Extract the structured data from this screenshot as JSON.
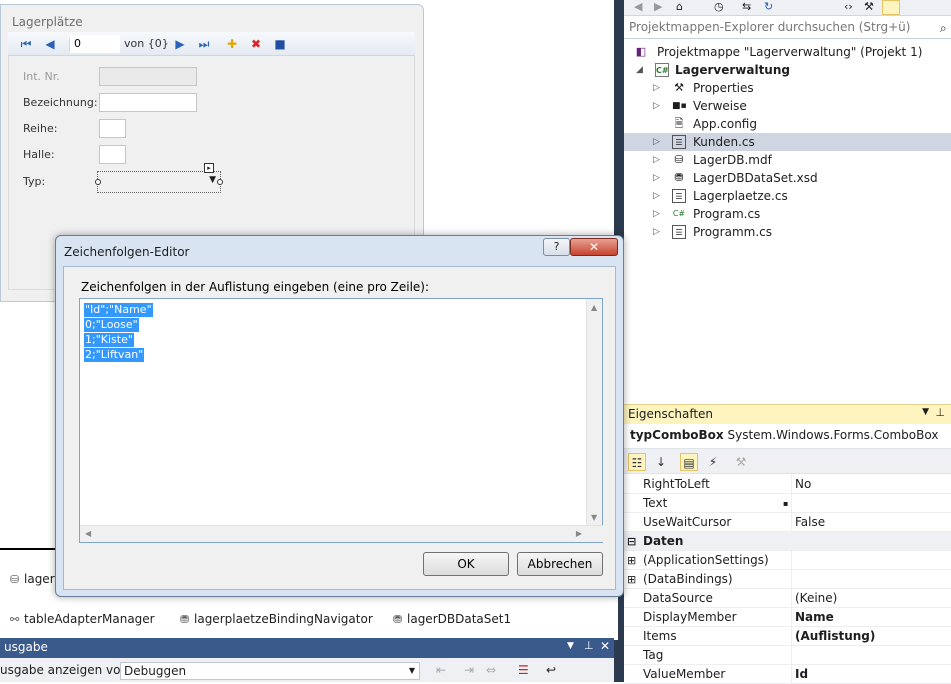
{
  "form": {
    "title": "Lagerplätze",
    "navigator": {
      "position": "0",
      "count_label": "von {0}"
    },
    "fields": [
      {
        "label": "Int. Nr."
      },
      {
        "label": "Bezeichnung:"
      },
      {
        "label": "Reihe:"
      },
      {
        "label": "Halle:"
      },
      {
        "label": "Typ:"
      }
    ]
  },
  "tray": {
    "items": [
      "lager",
      "tableAdapterManager",
      "lagerplaetzeBindingNavigator",
      "lagerDBDataSet1"
    ]
  },
  "output": {
    "title": "usgabe",
    "show_label": "usgabe anzeigen von:",
    "source": "Debuggen"
  },
  "dialog": {
    "title": "Zeichenfolgen-Editor",
    "help_label": "?",
    "close_label": "✕",
    "prompt": "Zeichenfolgen in der Auflistung eingeben (eine pro Zeile):",
    "lines": [
      "\"Id\";\"Name\"",
      "0;\"Loose\"",
      "1;\"Kiste\"",
      "2;\"Liftvan\""
    ],
    "ok_label": "OK",
    "cancel_label": "Abbrechen"
  },
  "solution_explorer": {
    "search_placeholder": "Projektmappen-Explorer durchsuchen (Strg+ü)",
    "items": [
      {
        "label": "Projektmappe \"Lagerverwaltung\" (Projekt 1)",
        "icon": "solution-icon"
      },
      {
        "label": "Lagerverwaltung",
        "icon": "csharp-project-icon"
      },
      {
        "label": "Properties",
        "icon": "wrench-icon"
      },
      {
        "label": "Verweise",
        "icon": "references-icon"
      },
      {
        "label": "App.config",
        "icon": "config-file-icon"
      },
      {
        "label": "Kunden.cs",
        "icon": "form-icon"
      },
      {
        "label": "LagerDB.mdf",
        "icon": "database-icon"
      },
      {
        "label": "LagerDBDataSet.xsd",
        "icon": "dataset-icon"
      },
      {
        "label": "Lagerplaetze.cs",
        "icon": "form-icon"
      },
      {
        "label": "Program.cs",
        "icon": "csharp-file-icon"
      },
      {
        "label": "Programm.cs",
        "icon": "form-icon"
      }
    ]
  },
  "properties": {
    "title": "Eigenschaften",
    "object_name": "typComboBox",
    "object_type": "System.Windows.Forms.ComboBox",
    "rows": [
      {
        "name": "RightToLeft",
        "value": "No"
      },
      {
        "name": "Text",
        "value": ""
      },
      {
        "name": "UseWaitCursor",
        "value": "False"
      },
      {
        "name": "Daten",
        "value": ""
      },
      {
        "name": "(ApplicationSettings)",
        "value": ""
      },
      {
        "name": "(DataBindings)",
        "value": ""
      },
      {
        "name": "DataSource",
        "value": "(Keine)"
      },
      {
        "name": "DisplayMember",
        "value": "Name"
      },
      {
        "name": "Items",
        "value": "(Auflistung)"
      },
      {
        "name": "Tag",
        "value": ""
      },
      {
        "name": "ValueMember",
        "value": "Id"
      }
    ]
  },
  "colors": {
    "accent": "#3399ff",
    "selection_row": "#cfd6e2",
    "properties_header": "#fdf4bf"
  }
}
